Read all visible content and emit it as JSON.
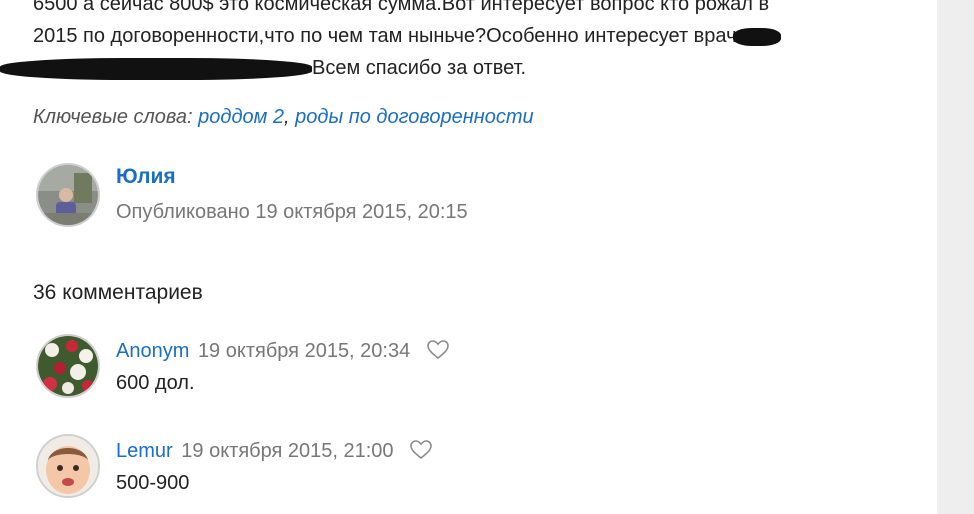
{
  "post": {
    "line1": "6500 а сейчас 800$ это космическая сумма.Вот интересует вопрос кто рожал в",
    "line2": "2015 по договоренности,что по чем там ныньче?Особенно интересует врач",
    "line3": "Всем спасибо за ответ."
  },
  "keywords": {
    "label": "Ключевые слова:",
    "items": [
      "роддом 2",
      "роды по договоренности"
    ],
    "separator": ", "
  },
  "author": {
    "name": "Юлия",
    "published": "Опубликовано 19 октября 2015, 20:15"
  },
  "comments": {
    "count_label": "36 комментариев",
    "items": [
      {
        "name": "Anonym",
        "date": "19 октября 2015, 20:34",
        "text": "600 дол."
      },
      {
        "name": "Lemur",
        "date": "19 октября 2015, 21:00",
        "text": "500-900"
      }
    ]
  },
  "icons": {
    "like": "heart-outline-icon"
  },
  "colors": {
    "link": "#1a6ec3",
    "muted": "#777777",
    "text": "#222222",
    "side_strip": "#eeeeee"
  }
}
